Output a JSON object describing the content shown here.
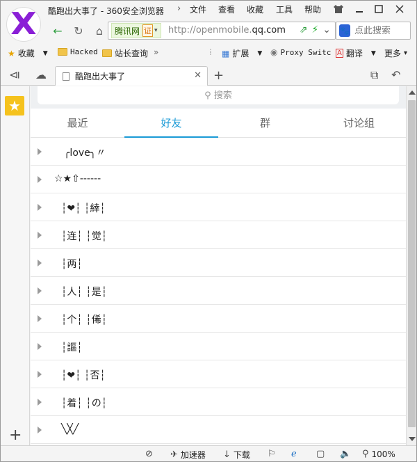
{
  "titlebar": {
    "page_title": "酷跑出大事了 - 360安全浏览器",
    "menus": [
      "文件",
      "查看",
      "收藏",
      "工具",
      "帮助"
    ]
  },
  "address": {
    "site_badge": "腾讯网",
    "cert_badge": "证",
    "url_prefix": "http://openmobile.",
    "url_domain": "qq.com",
    "search_placeholder": "点此搜索"
  },
  "bookmarks": {
    "favorites": "收藏",
    "items": [
      "Hacked",
      "站长查询"
    ],
    "extensions": "扩展",
    "proxy": "Proxy Switc",
    "translate": "翻译",
    "more": "更多"
  },
  "tab": {
    "title": "酷跑出大事了"
  },
  "content": {
    "search_placeholder": "搜索",
    "tabs": [
      "最近",
      "好友",
      "群",
      "讨论组"
    ],
    "active_tab": "好友",
    "groups": [
      "╭love╮〃",
      "☆★⇧------",
      "┆❤┆ ┆緈┆",
      "┆连┆ ┆觉┆",
      "┆两┆",
      "┆人┆ ┆是┆",
      "┆个┆ ┆俙┆",
      "┆謳┆",
      "┆❤┆ ┆否┆",
      "┆着┆ ┆の┆",
      "╲╳╱"
    ]
  },
  "statusbar": {
    "accelerator": "加速器",
    "download": "下载",
    "zoom": "100%"
  },
  "colors": {
    "accent": "#1a9ad6",
    "logo": "#8a1fd6",
    "star_tile": "#f5c21d"
  }
}
